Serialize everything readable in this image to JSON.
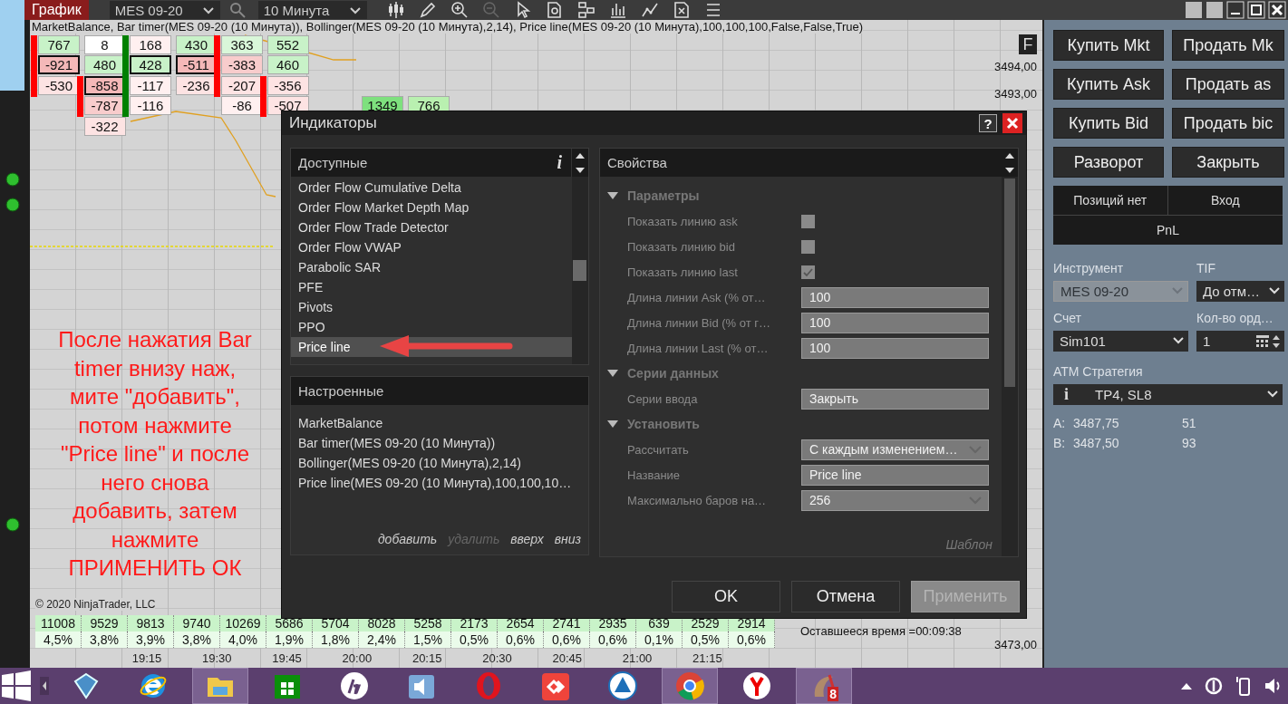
{
  "toolbar": {
    "tab": "График",
    "instrument": "MES 09-20",
    "interval": "10 Минута"
  },
  "chart": {
    "legend": "MarketBalance, Bar timer(MES 09-20 (10 Минута)), Bollinger(MES 09-20 (10 Минута),2,14), Price line(MES 09-20 (10 Минута),100,100,100,False,False,True)",
    "f_button": "F",
    "columns": [
      {
        "color": "#ff0000",
        "cells": [
          {
            "value": "767",
            "color": "#c8f2c8",
            "outlined": false,
            "bar": true
          },
          {
            "value": "-921",
            "color": "#f4b8b8",
            "outlined": true,
            "bar": true
          },
          {
            "value": "-530",
            "color": "#fde3e3",
            "outlined": false,
            "bar": true
          }
        ]
      },
      {
        "color": "#ff0000",
        "cells": [
          {
            "value": "8",
            "color": "#ffffff",
            "outlined": false,
            "bar": false
          },
          {
            "value": "480",
            "color": "#c8f2c8",
            "outlined": false,
            "bar": false
          },
          {
            "value": "-858",
            "color": "#f4b8b8",
            "outlined": true,
            "bar": true
          },
          {
            "value": "-787",
            "color": "#f8cccc",
            "outlined": false,
            "bar": true
          },
          {
            "value": "-322",
            "color": "#fde3e3",
            "outlined": false,
            "bar": false
          }
        ]
      },
      {
        "color": "#008000",
        "cells": [
          {
            "value": "168",
            "color": "#fff0f0",
            "outlined": false,
            "bar": true
          },
          {
            "value": "428",
            "color": "#c8f2c8",
            "outlined": true,
            "bar": true
          },
          {
            "value": "-117",
            "color": "#fff0f0",
            "outlined": false,
            "bar": true
          },
          {
            "value": "-116",
            "color": "#fff0f0",
            "outlined": false,
            "bar": true
          }
        ]
      },
      {
        "cells": [
          {
            "value": "430",
            "color": "#c8f2c8",
            "outlined": false
          },
          {
            "value": "-511",
            "color": "#f4b8b8",
            "outlined": true
          },
          {
            "value": "-236",
            "color": "#fde3e3",
            "outlined": false
          }
        ]
      },
      {
        "color": "#ff0000",
        "cells": [
          {
            "value": "363",
            "color": "#d9f7d9",
            "outlined": false,
            "bar": true
          },
          {
            "value": "-383",
            "color": "#f8cccc",
            "outlined": false,
            "bar": true
          },
          {
            "value": "-207",
            "color": "#fde3e3",
            "outlined": false,
            "bar": true
          },
          {
            "value": "-86",
            "color": "#fff0f0",
            "outlined": false,
            "bar": false
          }
        ]
      },
      {
        "color": "#ff0000",
        "cells": [
          {
            "value": "552",
            "color": "#c8f2c8",
            "outlined": false,
            "bar": false
          },
          {
            "value": "460",
            "color": "#c8f2c8",
            "outlined": false,
            "bar": false
          },
          {
            "value": "-356",
            "color": "#fde3e3",
            "outlined": false,
            "bar": true
          },
          {
            "value": "-507",
            "color": "#fde3e3",
            "outlined": false,
            "bar": true
          }
        ]
      }
    ],
    "extra_cells": [
      {
        "value": "1349",
        "color": "#7ee07e"
      },
      {
        "value": "766",
        "color": "#b9f0b0"
      }
    ],
    "price_labels": [
      "3494,00",
      "3493,00"
    ],
    "bottom_price": "3473,00",
    "volumes": [
      "11008",
      "9529",
      "9813",
      "9740",
      "10269",
      "5686",
      "5704",
      "8028",
      "5258",
      "2173",
      "2654",
      "2741",
      "2935",
      "639",
      "2529",
      "2914"
    ],
    "percents": [
      "4,5%",
      "3,8%",
      "3,9%",
      "3,8%",
      "4,0%",
      "1,9%",
      "1,8%",
      "2,4%",
      "1,5%",
      "0,5%",
      "0,6%",
      "0,6%",
      "0,6%",
      "0,1%",
      "0,5%",
      "0,6%"
    ],
    "copyright": "© 2020 NinjaTrader, LLC",
    "remaining": "Оставшееся время =00:09:38",
    "times": [
      "19:15",
      "19:30",
      "19:45",
      "20:00",
      "20:15",
      "20:30",
      "20:45",
      "21:00",
      "21:15"
    ],
    "annotation": [
      "После нажатия Bar",
      "timer внизу наж,",
      "мите \"добавить\",",
      "потом  нажмите",
      "\"Price line\" и после",
      "него снова",
      "добавить, затем",
      "нажмите",
      "ПРИМЕНИТЬ ОК"
    ]
  },
  "dialog": {
    "title": "Индикаторы",
    "help": "?",
    "available": {
      "header": "Доступные",
      "info": "i",
      "items": [
        {
          "label": "Order Flow Cumulative Delta",
          "selected": false
        },
        {
          "label": "Order Flow Market Depth Map",
          "selected": false
        },
        {
          "label": "Order Flow Trade Detector",
          "selected": false
        },
        {
          "label": "Order Flow VWAP",
          "selected": false
        },
        {
          "label": "Parabolic SAR",
          "selected": false
        },
        {
          "label": "PFE",
          "selected": false
        },
        {
          "label": "Pivots",
          "selected": false
        },
        {
          "label": "PPO",
          "selected": false
        },
        {
          "label": "Price line",
          "selected": true
        }
      ]
    },
    "configured": {
      "header": "Настроенные",
      "items": [
        "MarketBalance",
        "Bar timer(MES 09-20 (10 Минута))",
        "Bollinger(MES 09-20 (10 Минута),2,14)",
        "Price line(MES 09-20 (10 Минута),100,100,10…"
      ],
      "actions": [
        {
          "label": "добавить",
          "disabled": false
        },
        {
          "label": "удалить",
          "disabled": true
        },
        {
          "label": "вверх",
          "disabled": false
        },
        {
          "label": "вниз",
          "disabled": false
        }
      ]
    },
    "properties": {
      "header": "Свойства",
      "template": "Шаблон",
      "sections": [
        {
          "title": "Параметры",
          "expanded": true,
          "rows": [
            {
              "kind": "checkbox",
              "label": "Показать линию ask",
              "checked": false
            },
            {
              "kind": "checkbox",
              "label": "Показать линию bid",
              "checked": false
            },
            {
              "kind": "checkbox",
              "label": "Показать линию last",
              "checked": true
            },
            {
              "kind": "text",
              "label": "Длина линии Ask (% от…",
              "value": "100"
            },
            {
              "kind": "text",
              "label": "Длина линии Bid (% от г…",
              "value": "100"
            },
            {
              "kind": "text",
              "label": "Длина линии Last (% от…",
              "value": "100"
            }
          ]
        },
        {
          "title": "Серии данных",
          "expanded": true,
          "rows": [
            {
              "kind": "text",
              "label": "Серии ввода",
              "value": "Закрыть"
            }
          ]
        },
        {
          "title": "Установить",
          "expanded": true,
          "rows": [
            {
              "kind": "select",
              "label": "Рассчитать",
              "value": "С каждым изменением…"
            },
            {
              "kind": "text",
              "label": "Название",
              "value": "Price line"
            },
            {
              "kind": "select",
              "label": "Максимально баров на…",
              "value": "256"
            }
          ]
        }
      ]
    },
    "buttons": [
      {
        "label": "OK",
        "disabled": false
      },
      {
        "label": "Отмена",
        "disabled": false
      },
      {
        "label": "Применить",
        "disabled": true
      }
    ]
  },
  "order_panel": {
    "buttons": [
      "Купить Mkt",
      "Продать Mk",
      "Купить Ask",
      "Продать as",
      "Купить Bid",
      "Продать bic",
      "Разворот",
      "Закрыть"
    ],
    "position": "Позиций нет",
    "entry": "Вход",
    "pnl": "PnL",
    "fields": [
      {
        "label": "Инструмент",
        "value": "MES 09-20",
        "kind": "select",
        "disabled": true
      },
      {
        "label": "TIF",
        "value": "До отм…",
        "kind": "select",
        "disabled": false
      },
      {
        "label": "Счет",
        "value": "Sim101",
        "kind": "select",
        "disabled": false
      },
      {
        "label": "Кол-во орд…",
        "value": "1",
        "kind": "spinner",
        "disabled": false
      }
    ],
    "atm": {
      "label": "АТМ Стратегия",
      "info": "i",
      "value": "TP4, SL8"
    },
    "quotes": [
      {
        "side": "A:",
        "price": "3487,75",
        "size": "51"
      },
      {
        "side": "B:",
        "price": "3487,50",
        "size": "93"
      }
    ]
  },
  "taskbar": {
    "apps": [
      {
        "kind": "cube",
        "running": false
      },
      {
        "kind": "browser-e",
        "running": false
      },
      {
        "kind": "folder",
        "running": true
      },
      {
        "kind": "store",
        "running": false
      },
      {
        "kind": "hp",
        "running": false
      },
      {
        "kind": "speaker",
        "running": false
      },
      {
        "kind": "opera",
        "running": false
      },
      {
        "kind": "remote",
        "running": false
      },
      {
        "kind": "triangle",
        "running": false
      },
      {
        "kind": "chrome",
        "running": true
      },
      {
        "kind": "yandex",
        "running": false
      },
      {
        "kind": "ninja",
        "running": true,
        "badge": "8"
      }
    ]
  }
}
